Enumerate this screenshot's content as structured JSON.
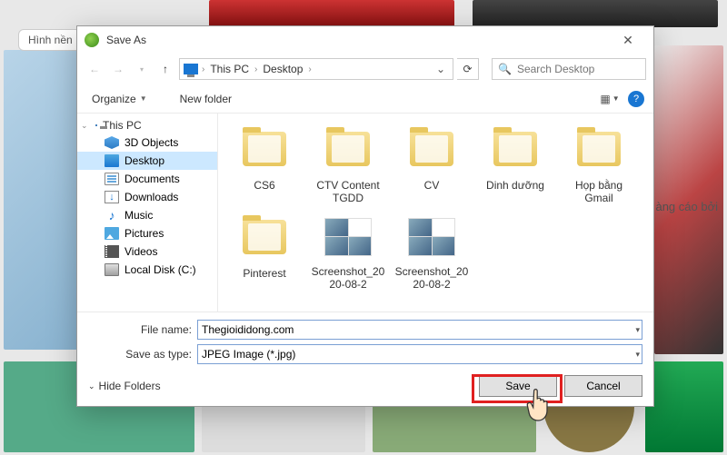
{
  "browser": {
    "tab_label": "Hình nền",
    "ad_text": "àng cáo bởi"
  },
  "dialog": {
    "title": "Save As",
    "path": {
      "segments": [
        "This PC",
        "Desktop"
      ]
    },
    "search": {
      "placeholder": "Search Desktop"
    },
    "toolbar": {
      "organize": "Organize",
      "new_folder": "New folder"
    },
    "tree": {
      "root": "This PC",
      "items": [
        {
          "label": "3D Objects",
          "icon": "cube"
        },
        {
          "label": "Desktop",
          "icon": "desktop",
          "selected": true
        },
        {
          "label": "Documents",
          "icon": "doc"
        },
        {
          "label": "Downloads",
          "icon": "down"
        },
        {
          "label": "Music",
          "icon": "music"
        },
        {
          "label": "Pictures",
          "icon": "pic"
        },
        {
          "label": "Videos",
          "icon": "vid"
        },
        {
          "label": "Local Disk (C:)",
          "icon": "disk"
        }
      ]
    },
    "files": [
      {
        "label": "CS6",
        "kind": "folder"
      },
      {
        "label": "CTV Content TGDD",
        "kind": "folder"
      },
      {
        "label": "CV",
        "kind": "folder"
      },
      {
        "label": "Dinh dưỡng",
        "kind": "folder"
      },
      {
        "label": "Họp bằng Gmail",
        "kind": "folder"
      },
      {
        "label": "Pinterest",
        "kind": "folder"
      },
      {
        "label": "Screenshot_2020-08-2",
        "kind": "image"
      },
      {
        "label": "Screenshot_2020-08-2",
        "kind": "image"
      }
    ],
    "file_name_label": "File name:",
    "file_name_value": "Thegioididong.com",
    "save_type_label": "Save as type:",
    "save_type_value": "JPEG Image (*.jpg)",
    "hide_folders": "Hide Folders",
    "save_btn": "Save",
    "cancel_btn": "Cancel"
  }
}
